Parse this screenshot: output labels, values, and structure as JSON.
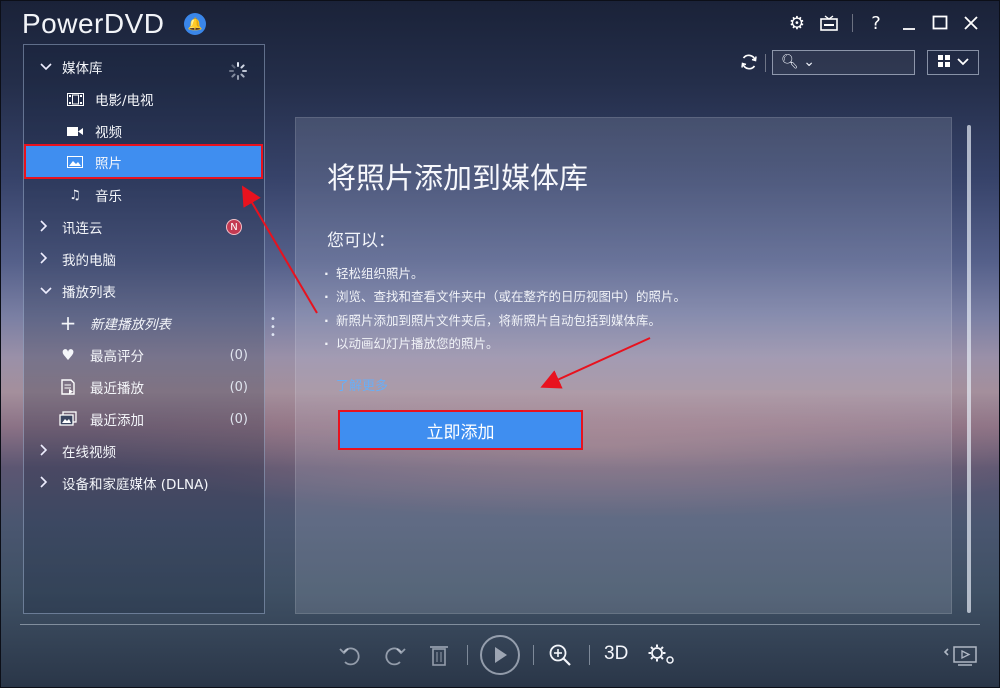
{
  "app": {
    "title": "PowerDVD"
  },
  "title_bar": {
    "buttons": [
      "gear-icon",
      "tv-mode-icon",
      "help-icon",
      "minimize-icon",
      "maximize-icon",
      "close-icon"
    ],
    "help_label": "?"
  },
  "sidebar": {
    "media_library": {
      "label": "媒体库"
    },
    "items": [
      {
        "label": "电影/电视",
        "icon": "film-icon"
      },
      {
        "label": "视频",
        "icon": "video-camera-icon"
      },
      {
        "label": "照片",
        "icon": "photo-icon",
        "selected": true
      },
      {
        "label": "音乐",
        "icon": "music-note-icon"
      }
    ],
    "cloud": {
      "label": "讯连云",
      "badge": "N"
    },
    "my_computer": {
      "label": "我的电脑"
    },
    "playlists": {
      "label": "播放列表",
      "items": [
        {
          "label": "新建播放列表",
          "icon": "plus-icon",
          "count": ""
        },
        {
          "label": "最高评分",
          "icon": "heart-icon",
          "count": "(0)"
        },
        {
          "label": "最近播放",
          "icon": "recent-play-icon",
          "count": "(0)"
        },
        {
          "label": "最近添加",
          "icon": "recent-add-icon",
          "count": "(0)"
        }
      ]
    },
    "online_video": {
      "label": "在线视频"
    },
    "dlna": {
      "label": "设备和家庭媒体 (DLNA)"
    }
  },
  "main": {
    "title": "将照片添加到媒体库",
    "subtitle": "您可以：",
    "bullets": [
      "轻松组织照片。",
      "浏览、查找和查看文件夹中（或在整齐的日历视图中）的照片。",
      "新照片添加到照片文件夹后，将新照片自动包括到媒体库。",
      "以动画幻灯片播放您的照片。"
    ],
    "learn_more": "了解更多",
    "add_now_button": "立即添加"
  },
  "bottom_bar": {
    "three_d_label": "3D"
  },
  "colors": {
    "accent": "#3f8ef0",
    "highlight_border": "#e8121e",
    "link": "#6aaef5"
  }
}
